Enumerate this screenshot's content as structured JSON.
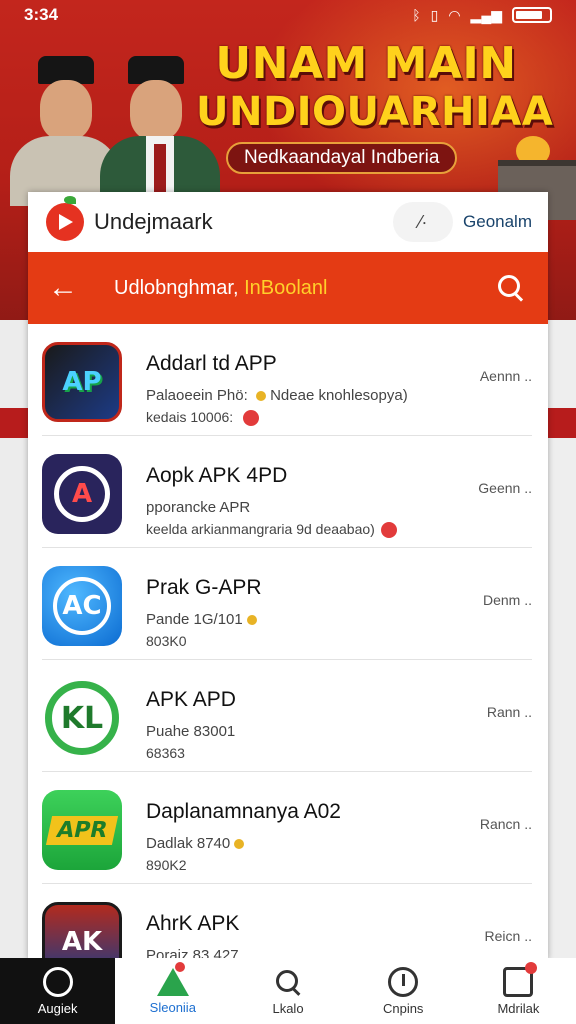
{
  "status_bar": {
    "time": "3:34",
    "icons": [
      "bluetooth-icon",
      "vibrate-icon",
      "wifi-icon",
      "signal-icon",
      "battery-icon"
    ]
  },
  "banner": {
    "title_line1": "UNAM MAIN",
    "title_line2": "UNDIOUARHIAA",
    "subtitle": "Nedkaandayal Indberia"
  },
  "header": {
    "brand": "Undejmaark",
    "right_link": "Geonalm",
    "pill_icon": "⁄∙"
  },
  "search": {
    "text_main": "Udlobnghmar, ",
    "text_highlight": "InBoolanl"
  },
  "apps": [
    {
      "name": "Addarl td APP",
      "line1": "Palaoeein Phö: ",
      "line1_extra": "Ndeae knohlesopya)",
      "line2": "kedais 10006: ",
      "action": "Aennn ..",
      "icon_text": "AP"
    },
    {
      "name": "Aopk APK 4PD",
      "line1": "pporancke APR",
      "line2": "keelda arkianmangraria 9d deaabao)",
      "action": "Geenn ..",
      "icon_text": "A"
    },
    {
      "name": "Prak G-APR",
      "line1": "Pande 1G/101",
      "line2": "803K0",
      "action": "Denm ..",
      "icon_text": "AC"
    },
    {
      "name": "APK APD",
      "line1": "Puahe 83001",
      "line2": "68363",
      "action": "Rann ..",
      "icon_text": "KL"
    },
    {
      "name": "Daplanamnanya A02",
      "line1": "Dadlak 8740",
      "line2": "890K2",
      "action": "Rancn ..",
      "icon_text": "APR"
    },
    {
      "name": "AhrK APK",
      "line1": "Poraiz 83 427",
      "line2": "",
      "action": "Reicn ..",
      "icon_text": "AK"
    }
  ],
  "bottom_nav": [
    {
      "label": "Augiek",
      "icon": "home-icon"
    },
    {
      "label": "Sleoniia",
      "icon": "apps-icon"
    },
    {
      "label": "Lkalo",
      "icon": "search-icon"
    },
    {
      "label": "Cnpins",
      "icon": "clock-icon"
    },
    {
      "label": "Mdrilak",
      "icon": "inbox-icon"
    }
  ],
  "colors": {
    "banner_red": "#c3261d",
    "search_orange": "#e43b14",
    "title_yellow": "#ffd21c",
    "nav_active": "#1d6fd0"
  }
}
